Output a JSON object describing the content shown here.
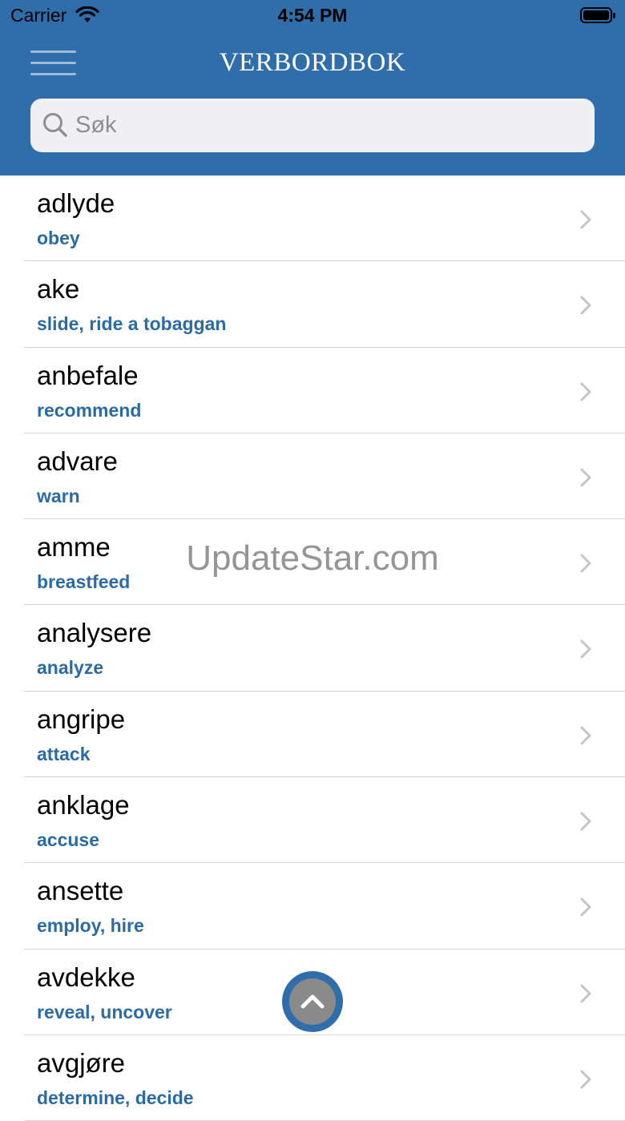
{
  "status_bar": {
    "carrier": "Carrier",
    "time": "4:54 PM"
  },
  "header": {
    "title": "VERBORDBOK",
    "menu_icon": "hamburger-menu-icon"
  },
  "search": {
    "placeholder": "Søk",
    "value": ""
  },
  "verbs": [
    {
      "word": "adlyde",
      "translation": "obey"
    },
    {
      "word": "ake",
      "translation": "slide, ride a tobaggan"
    },
    {
      "word": "anbefale",
      "translation": "recommend"
    },
    {
      "word": "advare",
      "translation": "warn"
    },
    {
      "word": "amme",
      "translation": "breastfeed"
    },
    {
      "word": "analysere",
      "translation": "analyze"
    },
    {
      "word": "angripe",
      "translation": "attack"
    },
    {
      "word": "anklage",
      "translation": "accuse"
    },
    {
      "word": "ansette",
      "translation": "employ, hire"
    },
    {
      "word": "avdekke",
      "translation": "reveal, uncover"
    },
    {
      "word": "avgjøre",
      "translation": "determine, decide"
    }
  ],
  "watermark": "UpdateStar.com",
  "colors": {
    "header": "#2f6eab",
    "translation": "#2a6ba6",
    "search_bg": "#efeff4"
  }
}
